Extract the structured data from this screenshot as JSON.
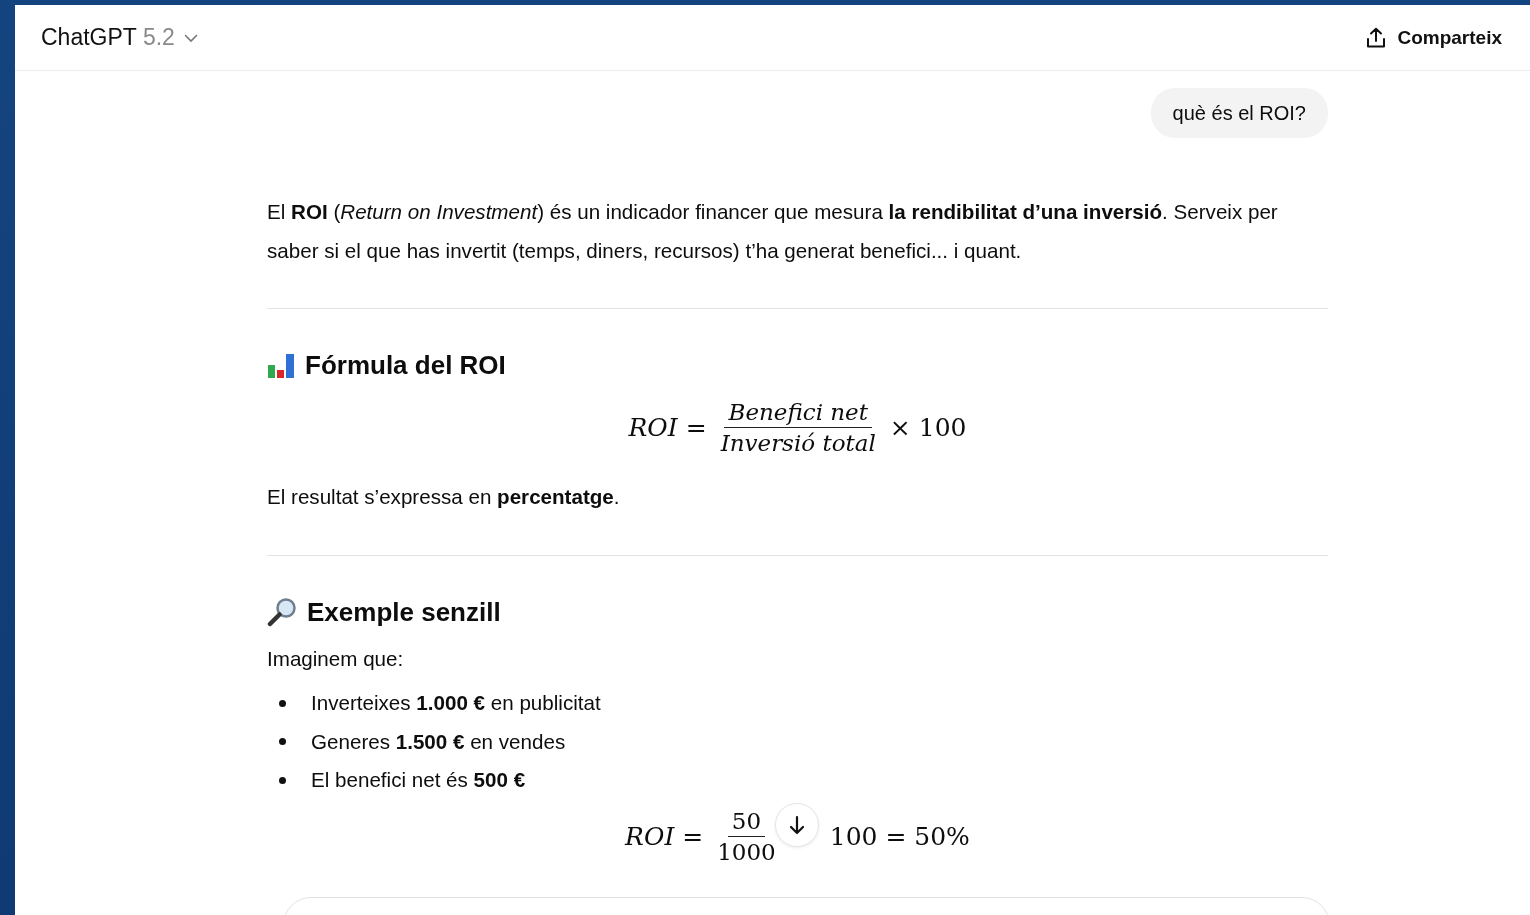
{
  "header": {
    "model_name": "ChatGPT",
    "model_version": "5.2",
    "share_label": "Comparteix"
  },
  "user_message": "què és el ROI?",
  "response": [
    {
      "kind": "paragraph",
      "text": "El **ROI** (*Return on Investment*) és un indicador financer que mesura **la rendibilitat d’una inversió**. Serveix per saber si el que has invertit (temps, diners, recursos) t’ha generat benefici... i quant."
    },
    {
      "kind": "divider"
    },
    {
      "kind": "heading",
      "text": "Fórmula del ROI"
    },
    {
      "kind": "formula",
      "lhs": "ROI =",
      "numerator": "Benefici net",
      "denominator": "Inversió total",
      "rhs": "× 100"
    },
    {
      "kind": "paragraph",
      "text": "El resultat s’expressa en **percentatge**."
    },
    {
      "kind": "divider"
    },
    {
      "kind": "heading",
      "text": "Exemple senzill"
    },
    {
      "kind": "paragraph",
      "text": "Imaginem que:"
    },
    {
      "kind": "bullets",
      "items": [
        "Inverteixes **1.000 €** en publicitat",
        "Generes **1.500 €** en vendes",
        "El benefici net és **500 €**"
      ]
    },
    {
      "kind": "formula",
      "lhs": "ROI =",
      "numerator": "50",
      "denominator": "1000",
      "rhs": "100 = 50%"
    }
  ]
}
